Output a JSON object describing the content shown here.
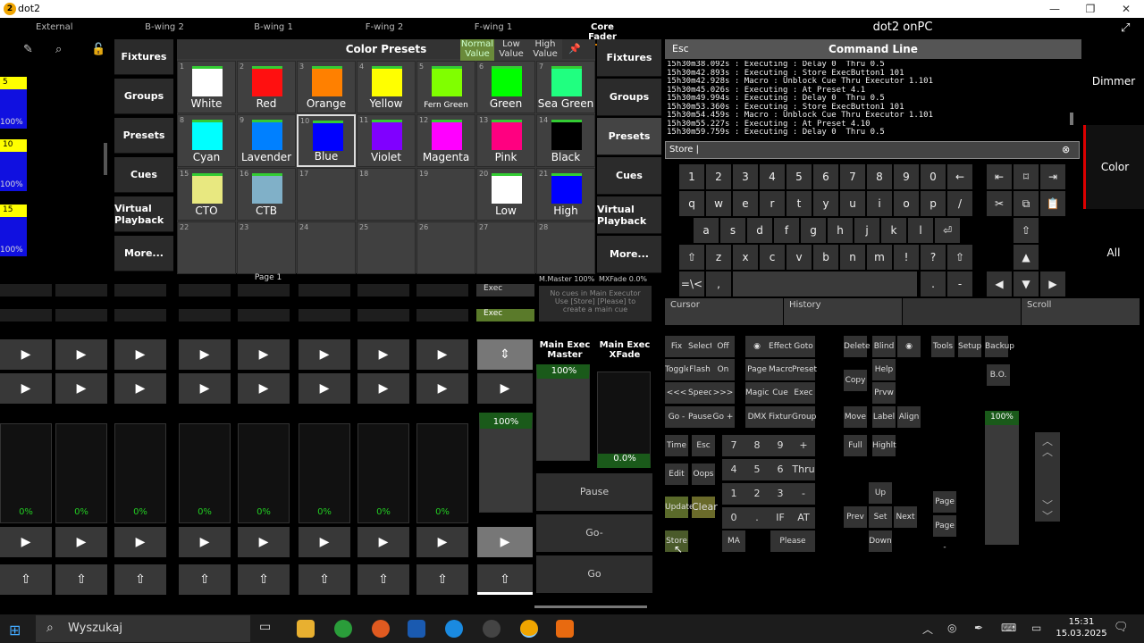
{
  "window": {
    "title": "dot2",
    "app_title": "dot2 onPC",
    "min": "—",
    "max": "❐",
    "close": "✕"
  },
  "tabs": [
    "External",
    "B-wing 2",
    "B-wing 1",
    "F-wing 2",
    "F-wing 1",
    "Core Fader"
  ],
  "exec_left": [
    {
      "n": "5",
      "pct": "100%"
    },
    {
      "n": "10",
      "pct": "100%"
    },
    {
      "n": "15",
      "pct": "100%"
    }
  ],
  "views_left": [
    "Fixtures",
    "Groups",
    "Presets",
    "Cues",
    "Virtual Playback",
    "More..."
  ],
  "views_right": [
    "Fixtures",
    "Groups",
    "Presets",
    "Cues",
    "Virtual Playback",
    "More..."
  ],
  "presets": {
    "title": "Color Presets",
    "normal": "Normal Value",
    "low": "Low Value",
    "high": "High Value",
    "cells": [
      {
        "n": "1",
        "label": "White",
        "color": "#ffffff"
      },
      {
        "n": "2",
        "label": "Red",
        "color": "#ff1010"
      },
      {
        "n": "3",
        "label": "Orange",
        "color": "#ff8000"
      },
      {
        "n": "4",
        "label": "Yellow",
        "color": "#ffff00"
      },
      {
        "n": "5",
        "label": "Fern Green",
        "color": "#80ff00"
      },
      {
        "n": "6",
        "label": "Green",
        "color": "#00ff00"
      },
      {
        "n": "7",
        "label": "Sea Green",
        "color": "#20ff80"
      },
      {
        "n": "8",
        "label": "Cyan",
        "color": "#00ffff"
      },
      {
        "n": "9",
        "label": "Lavender",
        "color": "#0080ff"
      },
      {
        "n": "10",
        "label": "Blue",
        "color": "#0000ff"
      },
      {
        "n": "11",
        "label": "Violet",
        "color": "#8000ff"
      },
      {
        "n": "12",
        "label": "Magenta",
        "color": "#ff00ff"
      },
      {
        "n": "13",
        "label": "Pink",
        "color": "#ff0080"
      },
      {
        "n": "14",
        "label": "Black",
        "color": "#000000"
      },
      {
        "n": "15",
        "label": "CTO",
        "color": "#e8e880"
      },
      {
        "n": "16",
        "label": "CTB",
        "color": "#80b0c8"
      },
      {
        "n": "17",
        "label": "",
        "color": ""
      },
      {
        "n": "18",
        "label": "",
        "color": ""
      },
      {
        "n": "19",
        "label": "",
        "color": ""
      },
      {
        "n": "20",
        "label": "Low",
        "color": "#ffffff"
      },
      {
        "n": "21",
        "label": "High",
        "color": "#0000ff"
      },
      {
        "n": "22",
        "label": "",
        "color": ""
      },
      {
        "n": "23",
        "label": "",
        "color": ""
      },
      {
        "n": "24",
        "label": "",
        "color": ""
      },
      {
        "n": "25",
        "label": "",
        "color": ""
      },
      {
        "n": "26",
        "label": "",
        "color": ""
      },
      {
        "n": "27",
        "label": "",
        "color": ""
      },
      {
        "n": "28",
        "label": "",
        "color": ""
      }
    ]
  },
  "command": {
    "esc": "Esc",
    "title": "Command Line",
    "input": "Store |",
    "log": [
      "15h30m38.092s : Executing : Delay 0  Thru 0.5",
      "15h30m42.893s : Executing : Store ExecButton1 101",
      "15h30m42.928s : Macro : Unblock Cue Thru Executor 1.101",
      "15h30m45.026s : Executing : At Preset 4.1",
      "15h30m49.994s : Executing : Delay 0  Thru 0.5",
      "15h30m53.360s : Executing : Store ExecButton1 101",
      "15h30m54.459s : Macro : Unblock Cue Thru Executor 1.101",
      "15h30m55.227s : Executing : At Preset 4.10",
      "15h30m59.759s : Executing : Delay 0  Thru 0.5"
    ]
  },
  "keyboard": {
    "row1": [
      "1",
      "2",
      "3",
      "4",
      "5",
      "6",
      "7",
      "8",
      "9",
      "0",
      "←"
    ],
    "row2": [
      "q",
      "w",
      "e",
      "r",
      "t",
      "y",
      "u",
      "i",
      "o",
      "p",
      "/"
    ],
    "row3": [
      "a",
      "s",
      "d",
      "f",
      "g",
      "h",
      "j",
      "k",
      "l",
      "⏎"
    ],
    "row4": [
      "⇧",
      "z",
      "x",
      "c",
      "v",
      "b",
      "n",
      "m",
      "!",
      "?",
      "⇧"
    ],
    "row5": [
      "=\\<",
      ",",
      ".",
      "-"
    ]
  },
  "sidebar": {
    "dimmer": "Dimmer",
    "color": "Color",
    "all": "All"
  },
  "bar": {
    "cursor": "Cursor",
    "history": "History",
    "scroll": "Scroll"
  },
  "page": "Page 1",
  "master": {
    "m": "M.Master 100%",
    "x": "MXFade 0.0%",
    "exec1": "Exec",
    "exec2": "Exec",
    "nocue": "No cues in Main Executor Use [Store] [Please] to create a main cue",
    "mem_label": "Main Exec Master",
    "xf_label": "Main Exec XFade",
    "mem_pct": "100%",
    "xf_pct": "0.0%",
    "pause": "Pause",
    "gominus": "Go-",
    "go": "Go"
  },
  "faders": {
    "pcts": [
      "0%",
      "0%",
      "0%",
      "0%",
      "0%",
      "0%",
      "0%",
      "0%"
    ],
    "master_pct": "100%"
  },
  "pad": {
    "btns": [
      "Fix",
      "Select",
      "Off",
      "◉",
      "Effect",
      "Goto",
      "Toggle",
      "Flash",
      "On",
      "Page",
      "Macro",
      "Preset",
      "<<<",
      "Speed",
      ">>>",
      "Magic",
      "Cue",
      "Exec",
      "Go -",
      "Pause",
      "Go +",
      "DMX",
      "Fixture",
      "Group",
      "Time",
      "Esc",
      "Edit",
      "Oops",
      "Update",
      "Clear",
      "Store",
      "MA",
      "Please"
    ],
    "nums": [
      "7",
      "8",
      "9",
      "+",
      "4",
      "5",
      "6",
      "Thru",
      "1",
      "2",
      "3",
      "-",
      "0",
      ".",
      "IF",
      "AT"
    ],
    "right": [
      "Delete",
      "Blind",
      "◉",
      "Tools",
      "Setup",
      "Backup",
      "Copy",
      "Help",
      "Prvw",
      "B.O.",
      "Move",
      "Label",
      "Align",
      "Full",
      "Highlt",
      "Up",
      "Prev",
      "Set",
      "Next",
      "Down",
      "Page +",
      "Page -"
    ],
    "level": "100%"
  },
  "taskbar": {
    "search": "Wyszukaj",
    "time": "15:31",
    "date": "15.03.2025"
  }
}
